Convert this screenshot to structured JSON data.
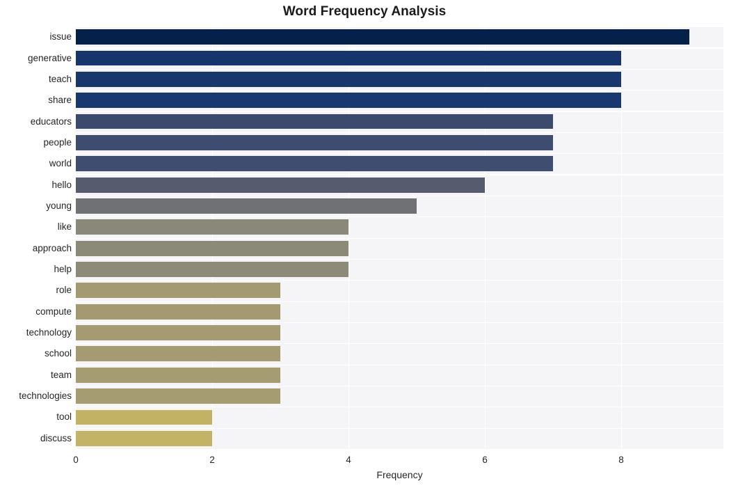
{
  "chart_data": {
    "type": "bar",
    "orientation": "horizontal",
    "title": "Word Frequency Analysis",
    "xlabel": "Frequency",
    "ylabel": "",
    "categories": [
      "issue",
      "generative",
      "teach",
      "share",
      "educators",
      "people",
      "world",
      "hello",
      "young",
      "like",
      "approach",
      "help",
      "role",
      "compute",
      "technology",
      "school",
      "team",
      "technologies",
      "tool",
      "discuss"
    ],
    "values": [
      9,
      8,
      8,
      8,
      7,
      7,
      7,
      6,
      5,
      4,
      4,
      4,
      3,
      3,
      3,
      3,
      3,
      3,
      2,
      2
    ],
    "bar_colors": [
      "#052049",
      "#17356d",
      "#19376f",
      "#1a3870",
      "#3c4a6e",
      "#3e4c70",
      "#3f4d71",
      "#565c6d",
      "#6f7175",
      "#8a8878",
      "#8b8978",
      "#8d8a79",
      "#a39a72",
      "#a39a72",
      "#a49b72",
      "#a49b72",
      "#a59c72",
      "#a59c72",
      "#c2b263",
      "#c3b364"
    ],
    "xlim": [
      0,
      9.5
    ],
    "xticks": [
      0,
      2,
      4,
      6,
      8
    ],
    "xtick_labels": [
      "0",
      "2",
      "4",
      "6",
      "8"
    ],
    "grid": true,
    "grid_color": "#ffffff",
    "plot_background": "#f5f5f7",
    "figure_background": "#ffffff",
    "legend": null,
    "colormap": "cividis"
  }
}
